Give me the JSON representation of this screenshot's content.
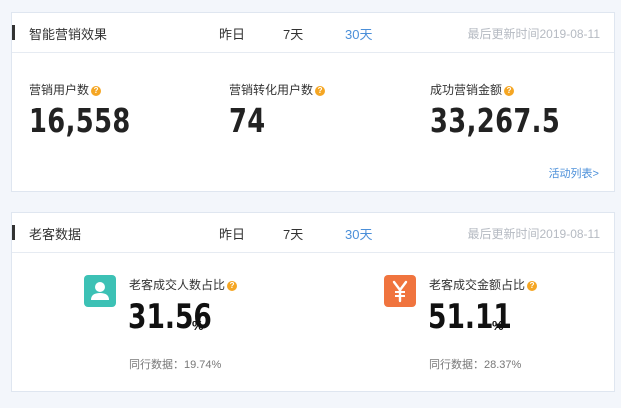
{
  "marketing": {
    "title": "智能营销效果",
    "tabs": [
      "昨日",
      "7天",
      "30天"
    ],
    "active_tab": "30天",
    "updated": "最后更新时间2019-08-11",
    "metrics": [
      {
        "label": "营销用户数",
        "value": "16,558"
      },
      {
        "label": "营销转化用户数",
        "value": "74"
      },
      {
        "label": "成功营销金额",
        "value": "33,267.5"
      }
    ],
    "link": "活动列表>"
  },
  "customers": {
    "title": "老客数据",
    "tabs": [
      "昨日",
      "7天",
      "30天"
    ],
    "active_tab": "30天",
    "updated": "最后更新时间2019-08-11",
    "stats": [
      {
        "label": "老客成交人数占比",
        "value": "31.56",
        "unit": "%",
        "peer": "同行数据：19.74%",
        "icon": "user-icon",
        "color": "#3cc1b5"
      },
      {
        "label": "老客成交金额占比",
        "value": "51.11",
        "unit": "%",
        "peer": "同行数据：28.37%",
        "icon": "yen-icon",
        "color": "#f0743e"
      }
    ]
  },
  "help_icon": "question-icon",
  "accent_color": "#4b8fd9"
}
